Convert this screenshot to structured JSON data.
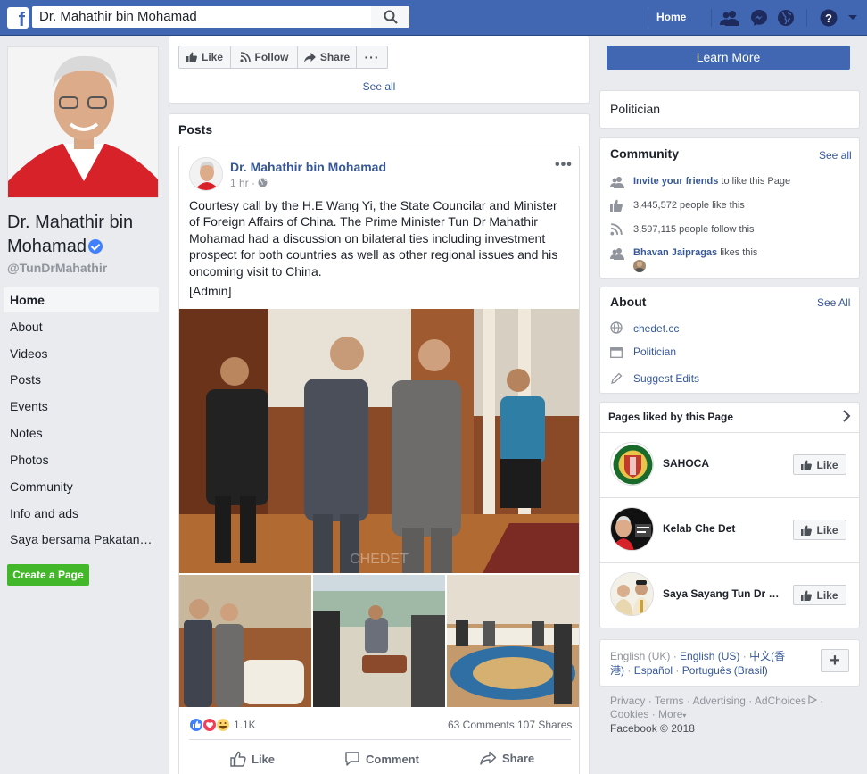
{
  "topbar": {
    "search_value": "Dr. Mahathir bin Mohamad",
    "home_label": "Home",
    "brand_color": "#4267b2"
  },
  "page": {
    "name": "Dr. Mahathir bin Mohamad",
    "handle": "@TunDrMahathir",
    "category": "Politician"
  },
  "nav": {
    "items": [
      "Home",
      "About",
      "Videos",
      "Posts",
      "Events",
      "Notes",
      "Photos",
      "Community",
      "Info and ads",
      "Saya bersama Pakatan Harapan"
    ],
    "create_page": "Create a Page"
  },
  "actions": {
    "like": "Like",
    "follow": "Follow",
    "share": "Share",
    "more": "···",
    "learn_more": "Learn More",
    "see_all": "See all"
  },
  "posts": {
    "header": "Posts",
    "author": "Dr. Mahathir bin Mohamad",
    "time": "1 hr",
    "text": "Courtesy call by the H.E Wang Yi, the State Councilar and Minister of Foreign Affairs of China. The Prime Minister Tun Dr Mahathir Mohamad had a discussion on bilateral ties including investment prospect for both countries as well as other regional issues and his oncoming visit to China.",
    "admin": "[Admin]",
    "watermark": "CHEDET",
    "reactions": "1.1K",
    "comments": "63 Comments",
    "shares": "107 Shares",
    "like_btn": "Like",
    "comment_btn": "Comment",
    "share_btn": "Share"
  },
  "sidebar": {
    "category": "Politician",
    "community": {
      "title": "Community",
      "see_all": "See all",
      "invite_link": "Invite your friends",
      "invite_rest": " to like this Page",
      "likes": "3,445,572 people like this",
      "follows": "3,597,115 people follow this",
      "friend_name": "Bhavan Jaipragas",
      "friend_rest": " likes this"
    },
    "about": {
      "title": "About",
      "see_all": "See All",
      "website": "chedet.cc",
      "category": "Politician",
      "suggest": "Suggest Edits"
    },
    "pages_liked": {
      "title": "Pages liked by this Page",
      "items": [
        {
          "name": "SAHOCA",
          "like": "Like"
        },
        {
          "name": "Kelab Che Det",
          "like": "Like"
        },
        {
          "name": "Saya Sayang Tun Dr Mahathir",
          "like": "Like"
        }
      ]
    },
    "languages": {
      "current": "English (UK)",
      "list": [
        "English (US)",
        "中文(香港)",
        "Español",
        "Português (Brasil)"
      ],
      "dot": "·",
      "plus": "+"
    },
    "footer": {
      "links": [
        "Privacy",
        "Terms",
        "Advertising",
        "AdChoices",
        "Cookies",
        "More"
      ],
      "copyright": "Facebook © 2018"
    }
  }
}
